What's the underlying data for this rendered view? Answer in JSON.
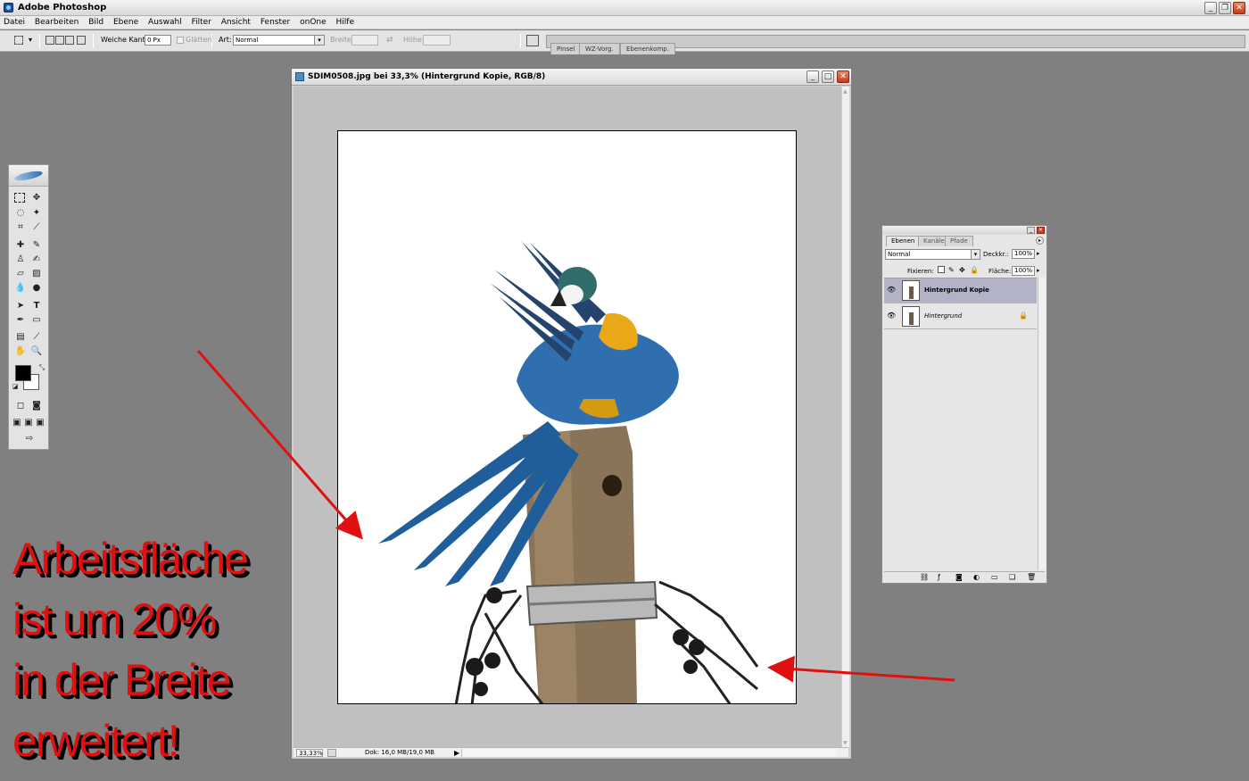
{
  "app": {
    "title": "Adobe Photoshop"
  },
  "menu": [
    "Datei",
    "Bearbeiten",
    "Bild",
    "Ebene",
    "Auswahl",
    "Filter",
    "Ansicht",
    "Fenster",
    "onOne",
    "Hilfe"
  ],
  "options": {
    "feather_label": "Weiche Kante:",
    "feather_value": "0 Px",
    "antialias_label": "Glätten",
    "style_label": "Art:",
    "style_value": "Normal",
    "width_label": "Breite:",
    "height_label": "Höhe:"
  },
  "palette_well": [
    "Pinsel",
    "WZ-Vorg.",
    "Ebenenkomp."
  ],
  "document": {
    "title": "SDIM0508.jpg bei 33,3% (Hintergrund Kopie, RGB/8)",
    "zoom": "33,33%",
    "doc_info": "Dok: 16,0 MB/19,0 MB"
  },
  "layers_panel": {
    "tabs": [
      "Ebenen",
      "Kanäle",
      "Pfade"
    ],
    "blend_mode": "Normal",
    "opacity_label": "Deckkr.:",
    "opacity_value": "100%",
    "lock_label": "Fixieren:",
    "fill_label": "Fläche:",
    "fill_value": "100%",
    "layers": [
      {
        "name": "Hintergrund Kopie",
        "selected": true,
        "locked": false
      },
      {
        "name": "Hintergrund",
        "selected": false,
        "locked": true
      }
    ]
  },
  "annotation": {
    "lines": [
      "Arbeitsfläche",
      "ist um 20%",
      "in der Breite",
      "erweitert!"
    ],
    "color": "#e01010"
  }
}
